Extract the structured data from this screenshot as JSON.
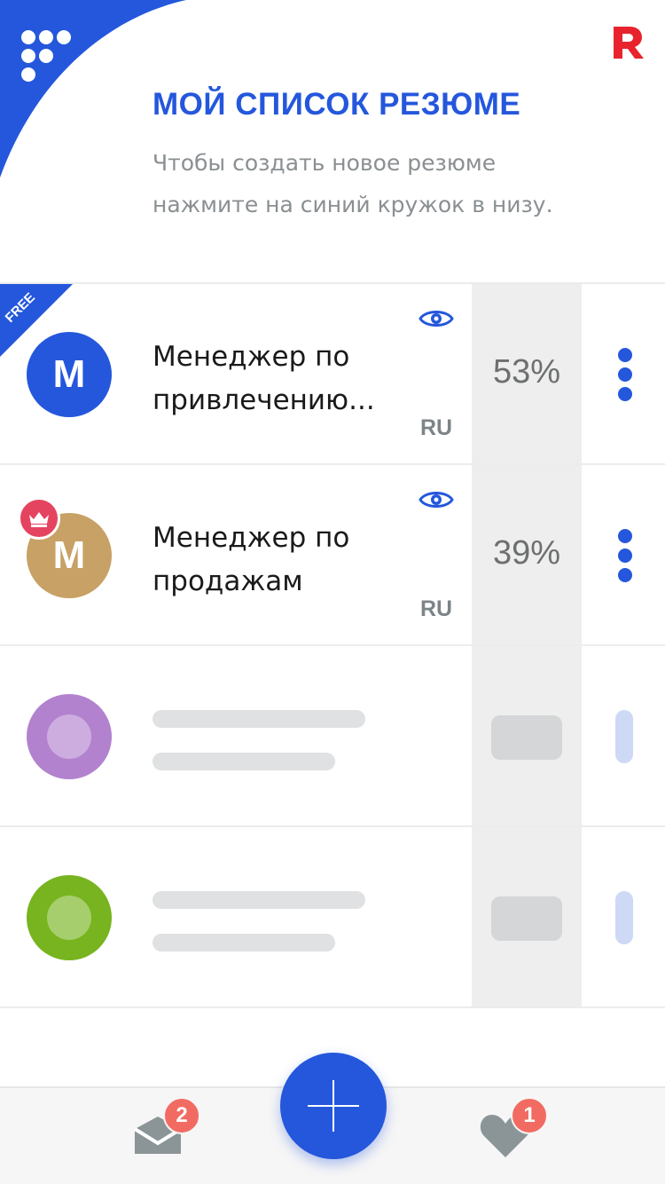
{
  "header": {
    "title": "МОЙ СПИСОК РЕЗЮМЕ",
    "subtitle": "Чтобы создать новое резюме нажмите на синий кружок в низу.",
    "menu_icon": "grid-dots-icon",
    "brand_icon": "r-logo-icon",
    "accent_color": "#2457dc"
  },
  "resumes": [
    {
      "initial": "M",
      "title": "Менеджер по привлечению...",
      "language": "RU",
      "percent": "53%",
      "badge": "FREE",
      "avatar_color": "#2457dc"
    },
    {
      "initial": "M",
      "title": "Менеджер по продажам",
      "language": "RU",
      "percent": "39%",
      "badge_icon": "crown-icon",
      "avatar_color": "#c7a165"
    }
  ],
  "placeholders": [
    {
      "avatar_color": "#b282cf"
    },
    {
      "avatar_color": "#77b41f"
    }
  ],
  "bottom_bar": {
    "messages_count": "2",
    "favorites_count": "1",
    "add_icon": "plus-icon"
  }
}
